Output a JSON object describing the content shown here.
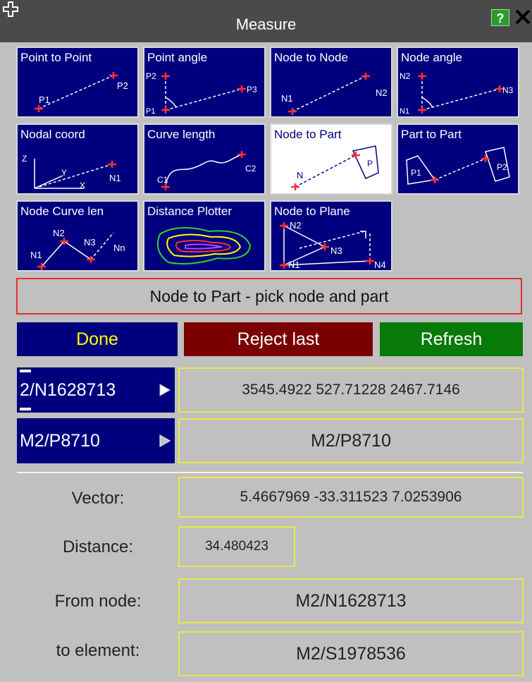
{
  "window": {
    "title": "Measure",
    "help_label": "?"
  },
  "tiles": [
    {
      "label": "Point to Point"
    },
    {
      "label": "Point angle"
    },
    {
      "label": "Node to Node"
    },
    {
      "label": "Node angle"
    },
    {
      "label": "Nodal coord"
    },
    {
      "label": "Curve length"
    },
    {
      "label": "Node to Part",
      "selected": true
    },
    {
      "label": "Part to Part"
    },
    {
      "label": "Node Curve len"
    },
    {
      "label": "Distance Plotter"
    },
    {
      "label": "Node to Plane"
    }
  ],
  "tile_text": {
    "p1": "P1",
    "p2": "P2",
    "p3": "P3",
    "n1": "N1",
    "n2": "N2",
    "n3": "N3",
    "n4": "N4",
    "nn": "Nn",
    "n": "N",
    "z": "Z",
    "y": "Y",
    "x": "X",
    "c1": "C1",
    "c2": "C2",
    "p": "P"
  },
  "status": {
    "text": "Node to Part - pick node and part"
  },
  "buttons": {
    "done": "Done",
    "reject": "Reject last",
    "refresh": "Refresh"
  },
  "node_pick": {
    "label": "2/N1628713",
    "coords": "3545.4922   527.71228   2467.7146"
  },
  "part_pick": {
    "label": "M2/P8710",
    "value": "M2/P8710"
  },
  "results": {
    "vector_label": "Vector:",
    "vector_value": "5.4667969  -33.311523   7.0253906",
    "distance_label": "Distance:",
    "distance_value": "34.480423",
    "from_node_label": "From node:",
    "from_node_value": "M2/N1628713",
    "to_element_label": "to element:",
    "to_element_value": "M2/S1978536"
  },
  "colors": {
    "tile_bg": "#00007e",
    "accent_red": "#e03030",
    "done_text": "#ffff00",
    "reject_bg": "#7a0000",
    "refresh_bg": "#087a08",
    "value_border": "#e8e84a"
  }
}
